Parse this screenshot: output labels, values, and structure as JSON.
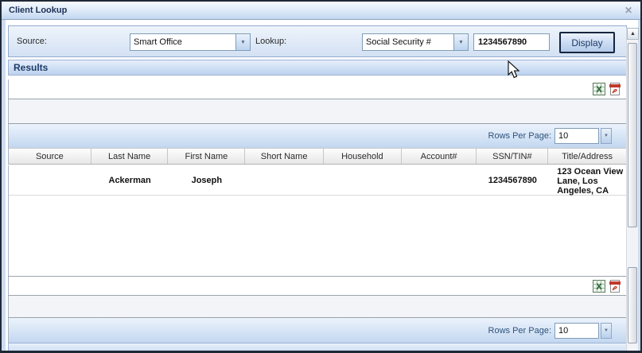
{
  "window": {
    "title": "Client Lookup",
    "close_glyph": "✕"
  },
  "toolbar": {
    "source_label": "Source:",
    "source_value": "Smart Office",
    "lookup_label": "Lookup:",
    "lookup_value": "Social Security #",
    "search_value": "1234567890",
    "display_label": "Display"
  },
  "results_header": "Results",
  "grid_top": {
    "rows_per_page_label": "Rows Per Page:",
    "rows_per_page_value": "10"
  },
  "grid_bottom": {
    "rows_per_page_label": "Rows Per Page:",
    "rows_per_page_value": "10"
  },
  "table": {
    "columns": [
      "Source",
      "Last Name",
      "First Name",
      "Short Name",
      "Household",
      "Account#",
      "SSN/TIN#",
      "Title/Address"
    ],
    "rows": [
      {
        "source": "",
        "last_name": "Ackerman",
        "first_name": "Joseph",
        "short_name": "",
        "household": "",
        "account": "",
        "ssn_tin": "1234567890",
        "title_address": "123 Ocean View Lane, Los Angeles, CA"
      }
    ]
  },
  "colors": {
    "title_text": "#1b3156",
    "header_bar": "#bcd2ee",
    "pager_text": "#2f537c",
    "border_dark": "#1e2836",
    "excel_green": "#1c5c2e",
    "pdf_red": "#c0392b"
  }
}
